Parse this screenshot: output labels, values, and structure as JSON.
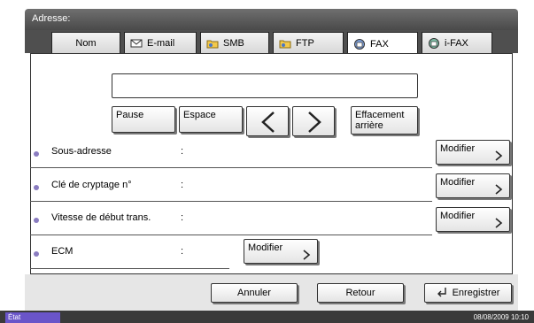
{
  "header": {
    "title": "Adresse:"
  },
  "tabs": [
    {
      "label": "Nom",
      "icon": "none"
    },
    {
      "label": "E-mail",
      "icon": "email-icon"
    },
    {
      "label": "SMB",
      "icon": "smb-folder-icon"
    },
    {
      "label": "FTP",
      "icon": "ftp-folder-icon"
    },
    {
      "label": "FAX",
      "icon": "fax-icon"
    },
    {
      "label": "i-FAX",
      "icon": "ifax-icon"
    }
  ],
  "entry": {
    "value": ""
  },
  "keys": {
    "pause": "Pause",
    "espace": "Espace",
    "left_arrow": "<",
    "right_arrow": ">",
    "effacement_line1": "Effacement",
    "effacement_line2": "arrière"
  },
  "rows": [
    {
      "label": "Sous-adresse",
      "colon": ":",
      "button": "Modifier"
    },
    {
      "label": "Clé de cryptage n°",
      "colon": ":",
      "button": "Modifier"
    },
    {
      "label": "Vitesse de début trans.",
      "colon": ":",
      "button": "Modifier"
    },
    {
      "label": "ECM",
      "colon": ":",
      "button": "Modifier"
    }
  ],
  "footer": {
    "cancel": "Annuler",
    "back": "Retour",
    "save": "Enregistrer"
  },
  "status": {
    "label": "État",
    "datetime": "08/08/2009   10:10"
  },
  "colors": {
    "accent": "#6a55c9",
    "header": "#4a4a4a"
  }
}
